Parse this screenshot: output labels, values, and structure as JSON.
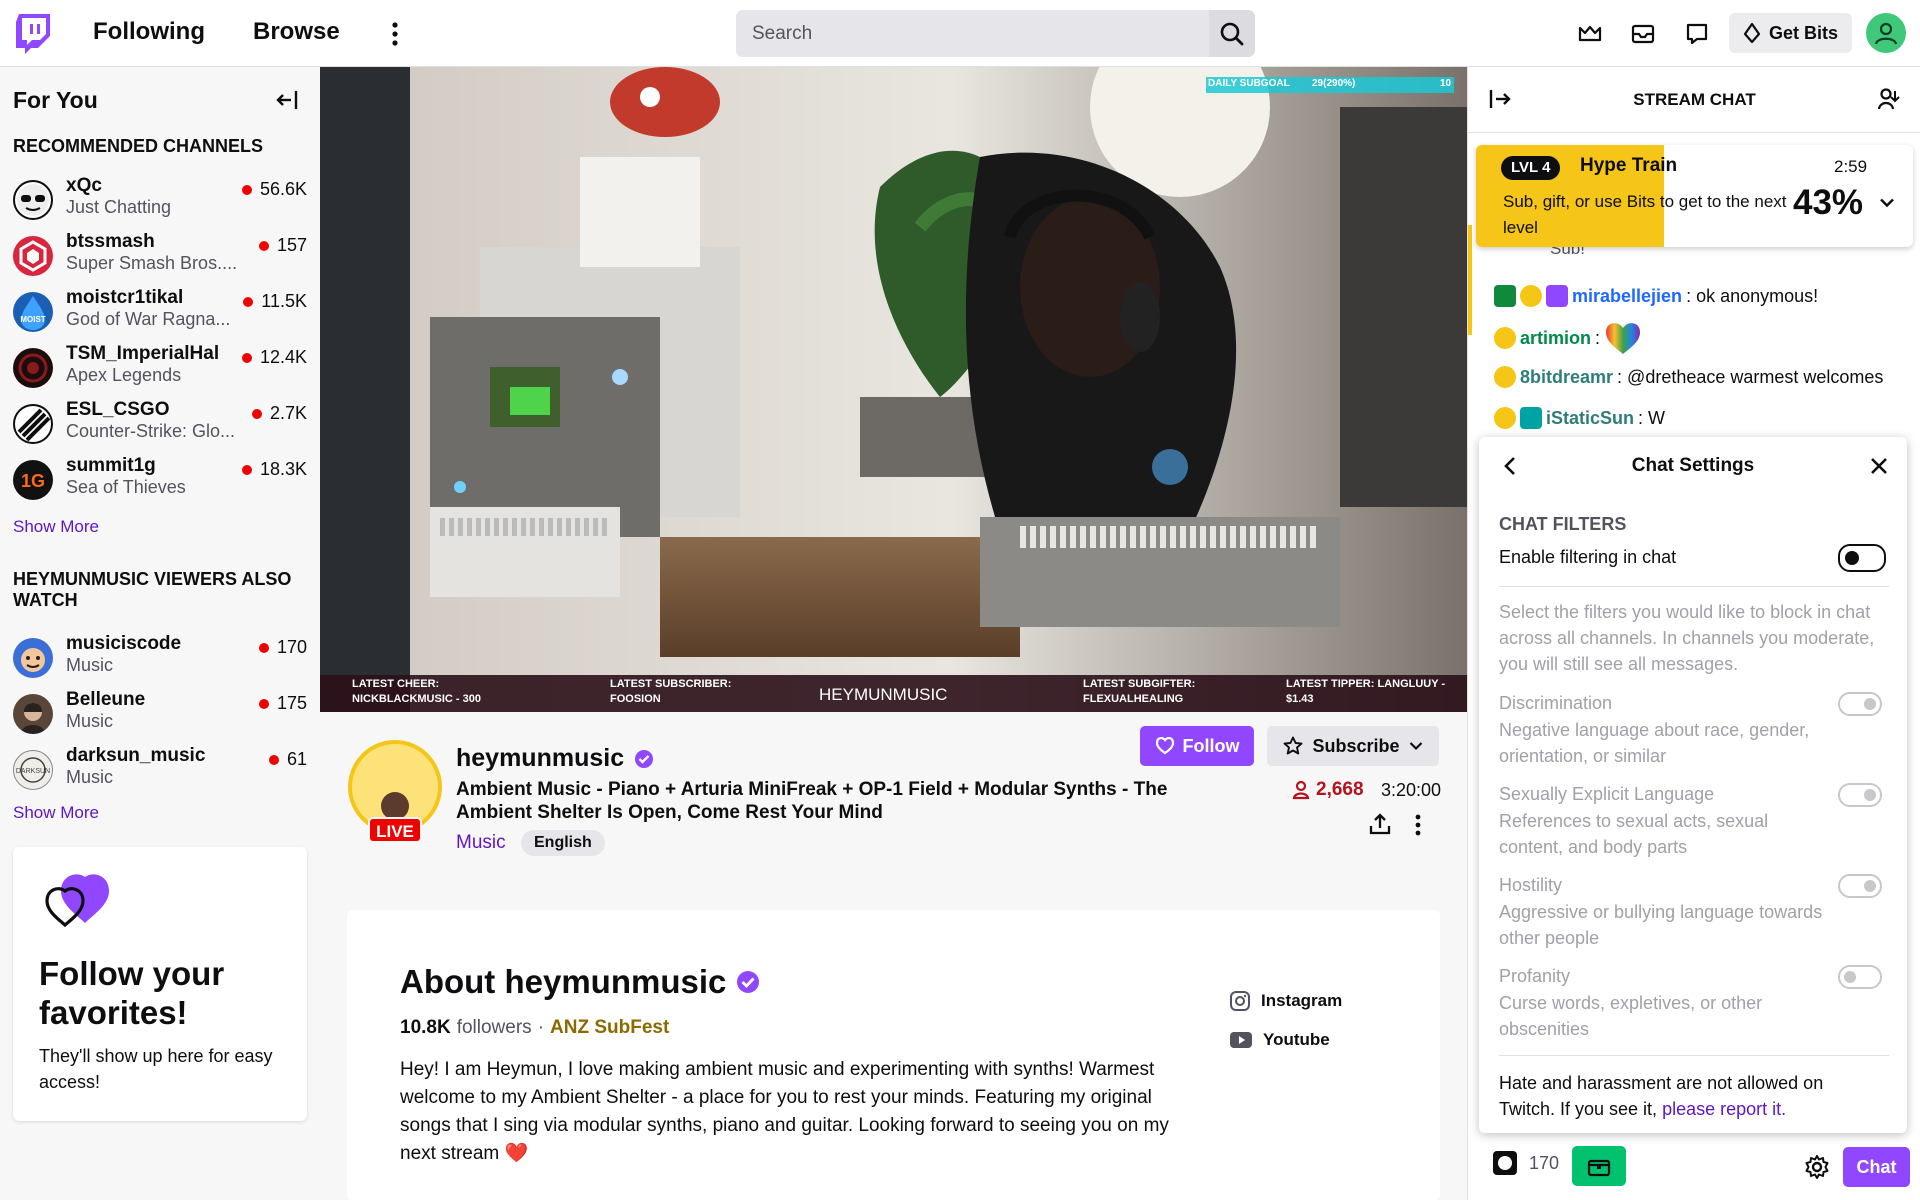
{
  "colors": {
    "brand": "#9147ff",
    "live": "#eb0400",
    "hype": "#f5c518",
    "accent_link": "#5c16c5"
  },
  "nav": {
    "following": "Following",
    "browse": "Browse",
    "search_placeholder": "Search",
    "get_bits": "Get Bits",
    "icons": [
      "twitch-logo-icon",
      "more-vertical-icon",
      "search-icon",
      "crown-icon",
      "inbox-icon",
      "whispers-icon",
      "bits-diamond-icon",
      "user-avatar-icon"
    ]
  },
  "sidebar": {
    "title": "For You",
    "recommended_heading": "RECOMMENDED CHANNELS",
    "recommended": [
      {
        "name": "xQc",
        "game": "Just Chatting",
        "viewers": "56.6K"
      },
      {
        "name": "btssmash",
        "game": "Super Smash Bros....",
        "viewers": "157"
      },
      {
        "name": "moistcr1tikal",
        "game": "God of War Ragna...",
        "viewers": "11.5K"
      },
      {
        "name": "TSM_ImperialHal",
        "game": "Apex Legends",
        "viewers": "12.4K"
      },
      {
        "name": "ESL_CSGO",
        "game": "Counter-Strike: Glo...",
        "viewers": "2.7K"
      },
      {
        "name": "summit1g",
        "game": "Sea of Thieves",
        "viewers": "18.3K"
      }
    ],
    "show_more": "Show More",
    "also_watch_heading": "HEYMUNMUSIC VIEWERS ALSO WATCH",
    "also_watch": [
      {
        "name": "musiciscode",
        "game": "Music",
        "viewers": "170"
      },
      {
        "name": "Belleune",
        "game": "Music",
        "viewers": "175"
      },
      {
        "name": "darksun_music",
        "game": "Music",
        "viewers": "61"
      }
    ],
    "show_more_2": "Show More",
    "follow_card": {
      "title": "Follow your favorites!",
      "body": "They'll show up here for easy access!"
    }
  },
  "video": {
    "overlay": {
      "daily_goal": "DAILY SUBGOAL",
      "goal_value": "29(290%)",
      "goal_end": "10",
      "latest_cheer_label": "LATEST CHEER:",
      "latest_cheer": "NICKBLACKMUSIC - 300",
      "latest_sub_label": "LATEST SUBSCRIBER:",
      "latest_sub": "FOOSION",
      "brand": "HEYMUNMUSIC",
      "latest_gifter_label": "LATEST SUBGIFTER:",
      "latest_gifter": "FLEXUALHEALING",
      "latest_tipper_label": "LATEST TIPPER: LANGLUUY -",
      "latest_tipper": "$1.43"
    }
  },
  "channel": {
    "name": "heymunmusic",
    "live": "LIVE",
    "title": "Ambient Music - Piano + Arturia MiniFreak + OP-1 Field + Modular Synths - The Ambient Shelter Is Open, Come Rest Your Mind",
    "category": "Music",
    "tag": "English",
    "follow": "Follow",
    "subscribe": "Subscribe",
    "viewers": "2,668",
    "uptime": "3:20:00"
  },
  "about": {
    "title": "About heymunmusic",
    "followers_count": "10.8K",
    "followers_label": "followers",
    "team": "ANZ SubFest",
    "bio": "Hey! I am Heymun, I love making ambient music and experimenting with synths! Warmest welcome to my Ambient Shelter - a place for you to rest your minds. Featuring my original songs that I sing via modular synths, piano and guitar. Looking forward to seeing you on my next stream ❤️",
    "links": [
      "Instagram",
      "Youtube"
    ]
  },
  "chat": {
    "header": "STREAM CHAT",
    "hype_train": {
      "level": "LVL 4",
      "title": "Hype Train",
      "body": "Sub, gift, or use Bits to get to the next level",
      "timer": "2:59",
      "percent": "43%",
      "progress": 0.43
    },
    "partial_text": "Sub!",
    "messages": [
      {
        "user": "mirabellejien",
        "color": "#1e69ff",
        "text": ": ok anonymous!"
      },
      {
        "user": "artimion",
        "color": "#008a4b",
        "text": ":"
      },
      {
        "user": "8bitdreamr",
        "color": "#2e7d7a",
        "text": ": @dretheace warmest welcomes"
      },
      {
        "user": "iStaticSun",
        "color": "#2e7d7a",
        "text": ": W"
      }
    ],
    "settings": {
      "title": "Chat Settings",
      "section": "CHAT FILTERS",
      "enable_label": "Enable filtering in chat",
      "description": "Select the filters you would like to block in chat across all channels. In channels you moderate, you will still see all messages.",
      "filters": [
        {
          "name": "Discrimination",
          "desc": "Negative language about race, gender, orientation, or similar",
          "on": true
        },
        {
          "name": "Sexually Explicit Language",
          "desc": "References to sexual acts, sexual content, and body parts",
          "on": true
        },
        {
          "name": "Hostility",
          "desc": "Aggressive or bullying language towards other people",
          "on": true
        },
        {
          "name": "Profanity",
          "desc": "Curse words, expletives, or other obscenities",
          "on": false
        }
      ],
      "footer_text": "Hate and harassment are not allowed on Twitch. If you see it,",
      "footer_link": "please report it."
    },
    "points": "170",
    "chat_button": "Chat"
  }
}
